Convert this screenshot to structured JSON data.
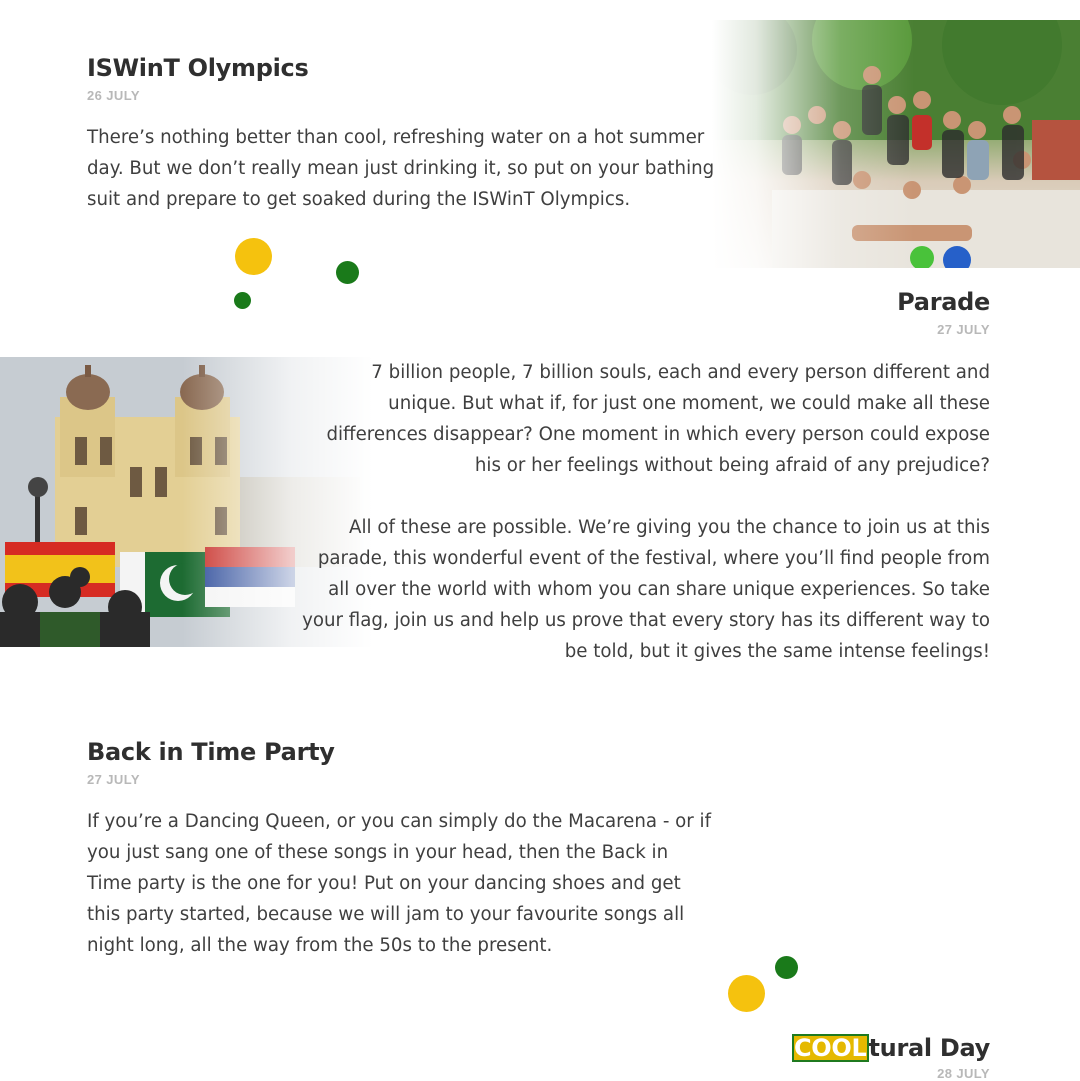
{
  "colors": {
    "yellow_dot": "#f5c20e",
    "green_dot": "#1a7a1a",
    "title": "#2f2f2f",
    "date": "#b8b8b8",
    "cool_highlight": "#e5b900"
  },
  "events": [
    {
      "title": "ISWinT Olympics",
      "date": "26 JULY",
      "lines": [
        "There’s nothing better than cool, refreshing water on a hot summer",
        "day. But we don’t really mean just drinking it, so put on your bathing",
        "suit and prepare to get soaked during the ISWinT Olympics."
      ]
    },
    {
      "title": "Parade",
      "date": "27 JULY",
      "lines": [
        "7 billion people, 7 billion souls, each and every person different and",
        "unique. But what if, for just one moment, we could make all these",
        "differences disappear? One moment in which every person could expose",
        "his or her feelings without being afraid of any prejudice?",
        "All of these are possible. We’re giving you the chance to join us at this",
        "parade, this wonderful event of the festival, where you’ll find people from",
        "all over the world with whom you can share unique experiences. So take",
        "your flag, join us and help us prove that every story has its different way to",
        "be told, but it gives the same intense feelings!"
      ]
    },
    {
      "title": "Back in Time Party",
      "date": "27 JULY",
      "lines": [
        "If you’re a Dancing Queen, or you can simply do the Macarena - or if",
        "you just sang one of these songs in your head, then the Back in",
        "Time party is the one for you! Put on your dancing shoes and get",
        "this party started, because we will jam to your favourite songs all",
        "night long, all the way from the 50s to the present."
      ]
    },
    {
      "title_highlight": "COOL",
      "title_rest": "tural Day",
      "date": "28 JULY"
    }
  ]
}
